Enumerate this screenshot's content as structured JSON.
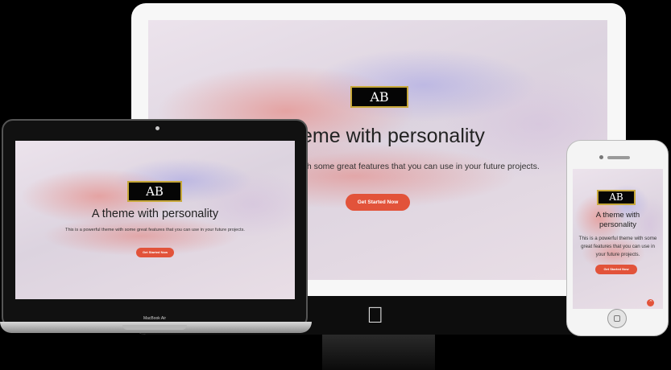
{
  "site": {
    "logo": "AB",
    "headline": "A theme with personality",
    "headline_cropped": "eme with personality",
    "subtitle": "This is a powerful theme with some great features that you can use in your future projects.",
    "subtitle_cropped": "with some great features that you can use in your future projects.",
    "cta_label": "Get Started Now"
  },
  "devices": {
    "laptop_label": "MacBook Air"
  },
  "colors": {
    "cta": "#e2533a",
    "logo_bg": "#050505",
    "logo_border": "#c7a83a"
  },
  "icons": {
    "desktop_brand": "apple-logo-icon",
    "scroll_top": "chevron-up-icon"
  }
}
